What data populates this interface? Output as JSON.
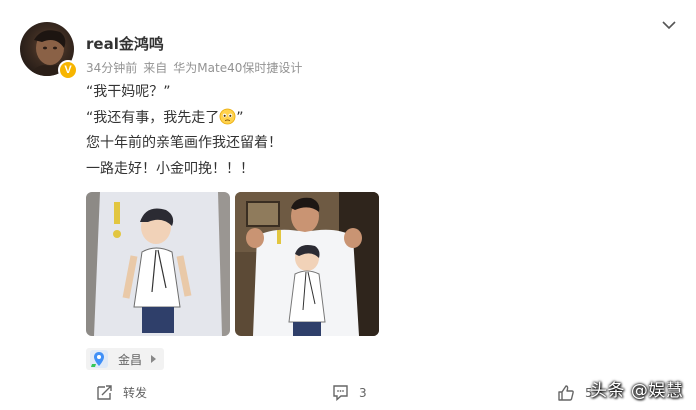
{
  "post": {
    "author": {
      "name": "real金鸿鸣",
      "verified_badge": "V",
      "avatar_icon": "avatar-photo"
    },
    "meta": {
      "time": "34分钟前",
      "source_prefix": "来自",
      "device": "华为Mate40保时捷设计"
    },
    "menu_icon": "chevron-down-icon",
    "lines": [
      "“我干妈呢？”",
      "“我还有事，我先走了",
      "”",
      "您十年前的亲笔画作我还留着！",
      "一路走好！小金叩挽！！！"
    ],
    "emoji_icon": "sad-face-emoji",
    "images": [
      {
        "name": "photo-tshirt-drawing",
        "icon": "tshirt-photo"
      },
      {
        "name": "photo-man-holding-tshirt",
        "icon": "man-with-tshirt-photo"
      }
    ],
    "location": {
      "label": "金昌",
      "icon": "location-pin-icon"
    }
  },
  "actions": {
    "repost_label": "转发",
    "comment_count": "3",
    "like_count": "5"
  },
  "watermark": "头条 @娱慧",
  "colors": {
    "text": "#333333",
    "meta": "#939393",
    "badge": "#f7b500",
    "pin_blue": "#3f8ff7",
    "pin_green": "#34c759"
  }
}
